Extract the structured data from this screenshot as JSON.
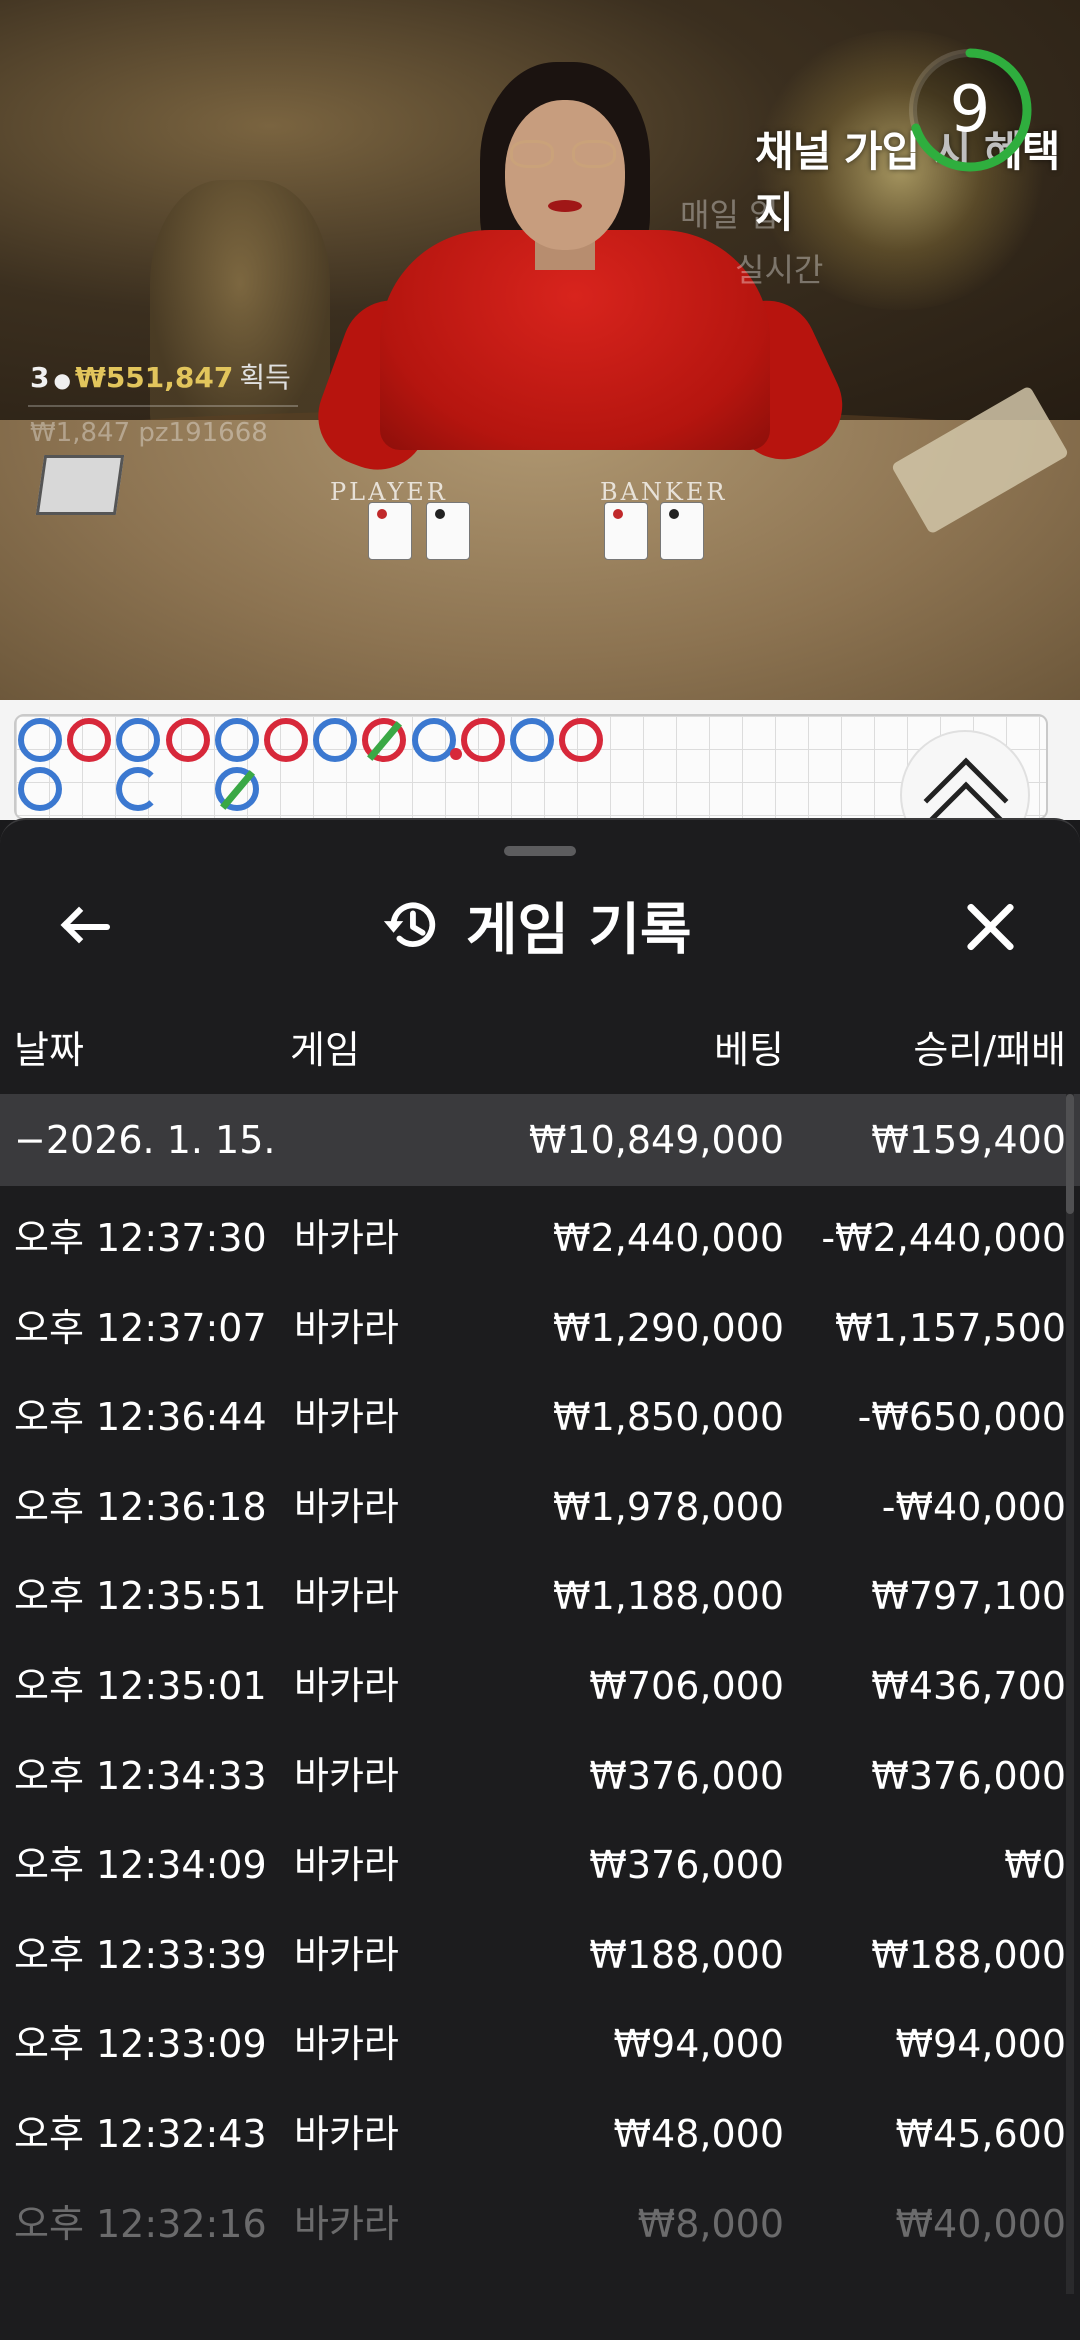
{
  "stream": {
    "timer": "9",
    "overlay_title": "채널 가입 시 혜택 지",
    "overlay_line2": "매일 입",
    "overlay_line3": "실시간",
    "table_player": "PLAYER",
    "table_banker": "BANKER",
    "winners": {
      "count": "3",
      "amount": "₩551,847",
      "suffix": "획득",
      "sub": "₩1,847  pz191668"
    }
  },
  "roadmap": {
    "row1": [
      "B",
      "R",
      "B",
      "R",
      "B",
      "R",
      "B",
      "R-tie",
      "B-dot",
      "R",
      "B",
      "R"
    ],
    "row2": [
      "B",
      "B-open",
      "B-tie"
    ]
  },
  "panel": {
    "title": "게임 기록",
    "columns": {
      "date": "날짜",
      "game": "게임",
      "bet": "베팅",
      "result": "승리/패배"
    },
    "summary": {
      "date": "−2026. 1. 15.",
      "bet": "₩10,849,000",
      "result": "₩159,400"
    },
    "rows": [
      {
        "time": "오후 12:37:30",
        "game": "바카라",
        "bet": "₩2,440,000",
        "result": "-₩2,440,000"
      },
      {
        "time": "오후 12:37:07",
        "game": "바카라",
        "bet": "₩1,290,000",
        "result": "₩1,157,500"
      },
      {
        "time": "오후 12:36:44",
        "game": "바카라",
        "bet": "₩1,850,000",
        "result": "-₩650,000"
      },
      {
        "time": "오후 12:36:18",
        "game": "바카라",
        "bet": "₩1,978,000",
        "result": "-₩40,000"
      },
      {
        "time": "오후 12:35:51",
        "game": "바카라",
        "bet": "₩1,188,000",
        "result": "₩797,100"
      },
      {
        "time": "오후 12:35:01",
        "game": "바카라",
        "bet": "₩706,000",
        "result": "₩436,700"
      },
      {
        "time": "오후 12:34:33",
        "game": "바카라",
        "bet": "₩376,000",
        "result": "₩376,000"
      },
      {
        "time": "오후 12:34:09",
        "game": "바카라",
        "bet": "₩376,000",
        "result": "₩0"
      },
      {
        "time": "오후 12:33:39",
        "game": "바카라",
        "bet": "₩188,000",
        "result": "₩188,000"
      },
      {
        "time": "오후 12:33:09",
        "game": "바카라",
        "bet": "₩94,000",
        "result": "₩94,000"
      },
      {
        "time": "오후 12:32:43",
        "game": "바카라",
        "bet": "₩48,000",
        "result": "₩45,600"
      },
      {
        "time": "오후 12:32:16",
        "game": "바카라",
        "bet": "₩8,000",
        "result": "₩40,000"
      }
    ]
  },
  "colors": {
    "player_blue": "#3b78d0",
    "banker_red": "#d7283a",
    "tie_green": "#3aa845",
    "timer_green": "#2fae3e",
    "panel_bg": "#1c1c1e",
    "summary_bg": "#3a3a3d"
  },
  "icons": {
    "back": "arrow-left-icon",
    "history": "history-icon",
    "close": "close-icon",
    "expand": "chevron-double-up-icon"
  }
}
